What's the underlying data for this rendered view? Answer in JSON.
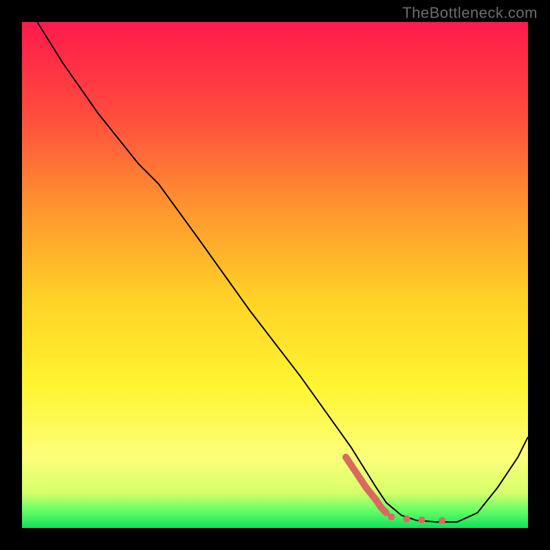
{
  "watermark": "TheBottleneck.com",
  "chart_data": {
    "type": "line",
    "title": "",
    "xlabel": "",
    "ylabel": "",
    "xlim": [
      0,
      100
    ],
    "ylim": [
      0,
      100
    ],
    "grid": false,
    "legend": false,
    "series": [
      {
        "name": "curve",
        "color": "#000000",
        "stroke_width": 2,
        "x": [
          3,
          8,
          15,
          23,
          27,
          35,
          45,
          55,
          65,
          70,
          72,
          75,
          78,
          82,
          86,
          90,
          94,
          98,
          100
        ],
        "y": [
          100,
          92,
          82,
          72,
          68,
          57,
          43,
          30,
          16,
          8,
          5,
          2.5,
          1.5,
          1.2,
          1.2,
          3,
          8,
          14,
          18
        ]
      },
      {
        "name": "accent-dots",
        "color": "#d96a5f",
        "stroke_width": 10,
        "x": [
          64,
          66,
          68,
          70,
          71,
          72,
          73,
          76,
          79,
          83
        ],
        "y": [
          14,
          11,
          8,
          5.5,
          4,
          3,
          2.2,
          1.8,
          1.6,
          1.5
        ]
      }
    ],
    "background": {
      "type": "vertical-gradient",
      "stops": [
        {
          "pos": 0.0,
          "color": "#ff1a4b"
        },
        {
          "pos": 0.18,
          "color": "#ff4a3e"
        },
        {
          "pos": 0.38,
          "color": "#ff9a2e"
        },
        {
          "pos": 0.55,
          "color": "#ffd327"
        },
        {
          "pos": 0.72,
          "color": "#fff531"
        },
        {
          "pos": 0.86,
          "color": "#fdff7a"
        },
        {
          "pos": 0.93,
          "color": "#d6ff6a"
        },
        {
          "pos": 0.965,
          "color": "#66ff66"
        },
        {
          "pos": 1.0,
          "color": "#11e05b"
        }
      ]
    }
  }
}
